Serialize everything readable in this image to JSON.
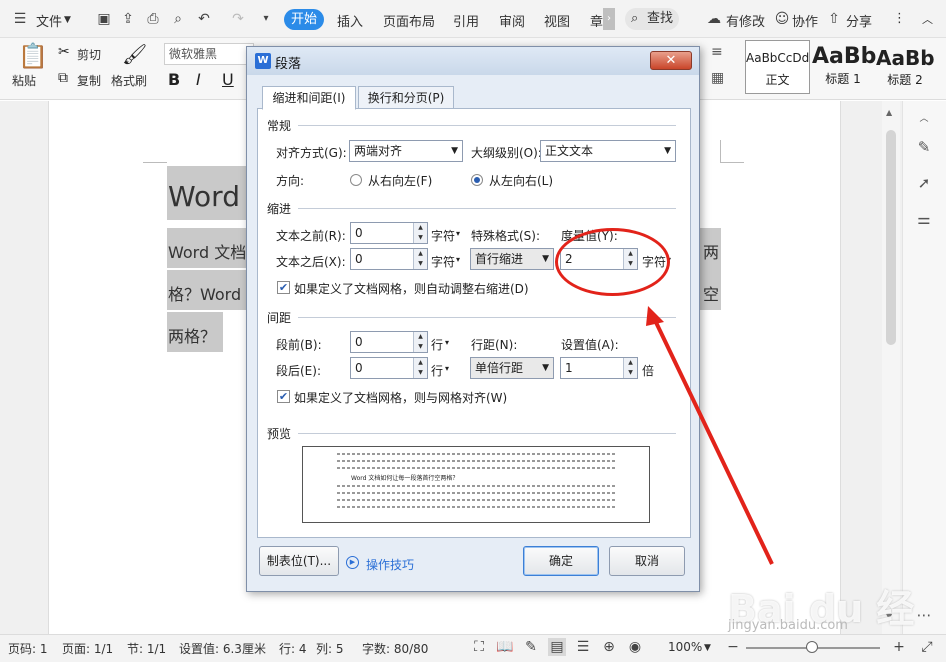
{
  "menubar": {
    "file": "文件",
    "tabs": [
      "开始",
      "插入",
      "页面布局",
      "引用",
      "审阅",
      "视图",
      "章"
    ],
    "search": "查找",
    "revise": "有修改",
    "collab": "协作",
    "share": "分享"
  },
  "ribbon": {
    "paste": "粘贴",
    "cut": "剪切",
    "copy": "复制",
    "format_painter": "格式刷",
    "font_name": "微软雅黑",
    "bold": "B",
    "italic": "I",
    "underline": "U",
    "styles": [
      {
        "preview": "AaBbCcDd",
        "name": "正文"
      },
      {
        "preview": "AaBb",
        "name": "标题 1"
      },
      {
        "preview": "AaBb",
        "name": "标题 2"
      }
    ]
  },
  "document": {
    "line1": "Word",
    "line2_left": "Word 文档",
    "line2_right": "两",
    "line3_left": "格？Word",
    "line3_right": "空",
    "line4": "两格？"
  },
  "dialog": {
    "title": "段落",
    "close": "✕",
    "tab_indent": "缩进和间距(I)",
    "tab_page": "换行和分页(P)",
    "general": {
      "heading": "常规",
      "alignment_label": "对齐方式(G):",
      "alignment_value": "两端对齐",
      "outline_label": "大纲级别(O):",
      "outline_value": "正文文本",
      "direction_label": "方向:",
      "rtl": "从右向左(F)",
      "ltr": "从左向右(L)"
    },
    "indent": {
      "heading": "缩进",
      "before_label": "文本之前(R):",
      "before_value": "0",
      "unit_before": "字符",
      "special_label": "特殊格式(S):",
      "degree_label": "度量值(Y):",
      "after_label": "文本之后(X):",
      "after_value": "0",
      "unit_after": "字符",
      "special_value": "首行缩进",
      "degree_value": "2",
      "unit_degree": "字符",
      "grid_check": "如果定义了文档网格，则自动调整右缩进(D)"
    },
    "spacing": {
      "heading": "间距",
      "before_label": "段前(B):",
      "before_value": "0",
      "unit_before": "行",
      "line_label": "行距(N):",
      "set_label": "设置值(A):",
      "after_label": "段后(E):",
      "after_value": "0",
      "unit_after": "行",
      "line_value": "单倍行距",
      "set_value": "1",
      "unit_set": "倍",
      "grid_check": "如果定义了文档网格，则与网格对齐(W)"
    },
    "preview": {
      "heading": "预览",
      "sample_line": "Word 文档如何让每一段落首行空两格？"
    },
    "tabs_button": "制表位(T)...",
    "tips": "操作技巧",
    "ok": "确定",
    "cancel": "取消"
  },
  "statusbar": {
    "page_num": "页码: 1",
    "page_count": "页面: 1/1",
    "section": "节: 1/1",
    "set_value": "设置值: 6.3厘米",
    "row": "行: 4",
    "col": "列: 5",
    "words": "字数: 80/80",
    "zoom": "100%"
  },
  "watermark": {
    "main": "Bai du 经验",
    "sub": "jingyan.baidu.com"
  },
  "colors": {
    "accent": "#2b8be8",
    "annotation": "#e2231a"
  }
}
